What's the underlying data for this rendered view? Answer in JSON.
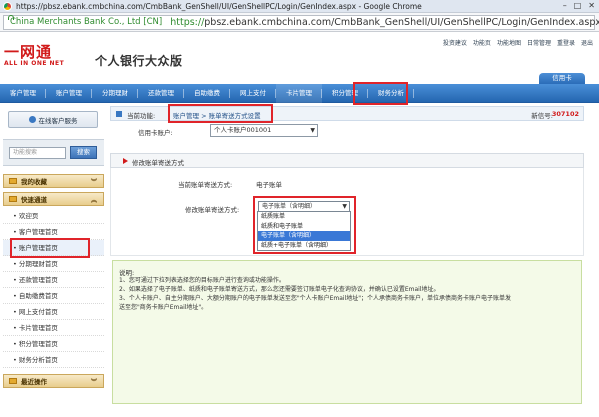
{
  "browser": {
    "window_title": "https://pbsz.ebank.cmbchina.com/CmbBank_GenShell/UI/GenShellPC/Login/GenIndex.aspx - Google Chrome",
    "cert_name": "China Merchants Bank Co., Ltd [CN]",
    "url_proto": "https://",
    "url_rest": "pbsz.ebank.cmbchina.com/CmbBank_GenShell/UI/GenShellPC/Login/GenIndex.aspx"
  },
  "header": {
    "logo_cn": "一网通",
    "logo_en": "ALL IN ONE NET",
    "bank_title": "个人银行大众版",
    "top_links": [
      "投资建议",
      "功能页",
      "功能地图",
      "日常管理",
      "重登录",
      "退出"
    ],
    "card_tab": "信用卡"
  },
  "nav": {
    "items": [
      "客户管理",
      "账户管理",
      "分期理财",
      "还款管理",
      "自助缴费",
      "网上支付",
      "卡片管理",
      "积分管理",
      "财务分析"
    ],
    "active_index": 6
  },
  "sidebar": {
    "online_service": "在线客户服务",
    "search_placeholder": "功能搜索",
    "search_button": "搜索",
    "favorites_label": "我的收藏",
    "quick_label": "快速通道",
    "items": [
      "欢迎页",
      "客户管理首页",
      "账户管理首页",
      "分期理财首页",
      "还款管理首页",
      "自助缴费首页",
      "网上支付首页",
      "卡片管理首页",
      "积分管理首页",
      "财务分析首页"
    ],
    "current_index": 2,
    "recent_label": "最近操作"
  },
  "content": {
    "crumb_label": "当前功能:",
    "crumb_path": "账户管理 > 账单寄送方式设置",
    "balance_label": "新信号:",
    "balance_value": "307102",
    "account_label": "信用卡账户:",
    "account_value": "个人卡账户001001",
    "section_title": "修改账单寄送方式",
    "current_method_label": "当前账单寄送方式:",
    "current_method_value": "电子账单",
    "modify_label": "修改账单寄送方式:",
    "modify_selected": "电子账单（含明细）",
    "dropdown_options": [
      "纸质账单",
      "纸质和电子账单",
      "电子账单（含明细）",
      "纸质+电子账单（含明细）"
    ],
    "dropdown_selected_index": 2,
    "note_title": "说明:",
    "note_lines": [
      "1、您可通过下拉列表选择您的目标账户进行查询或功能操作。",
      "2、如果选择了电子账单、纸质和电子账单寄送方式，那么您还需要签订账单电子化查询协议，并确认已设置Email地址。",
      "3、个人卡账户、自主分期账户、大额分期账户的电子账单发送至您\"个人卡账户Email地址\"；个人承债商务卡账户，单位承债商务卡账户电子账单发",
      "送至您\"商务卡账户Email地址\"。"
    ]
  }
}
